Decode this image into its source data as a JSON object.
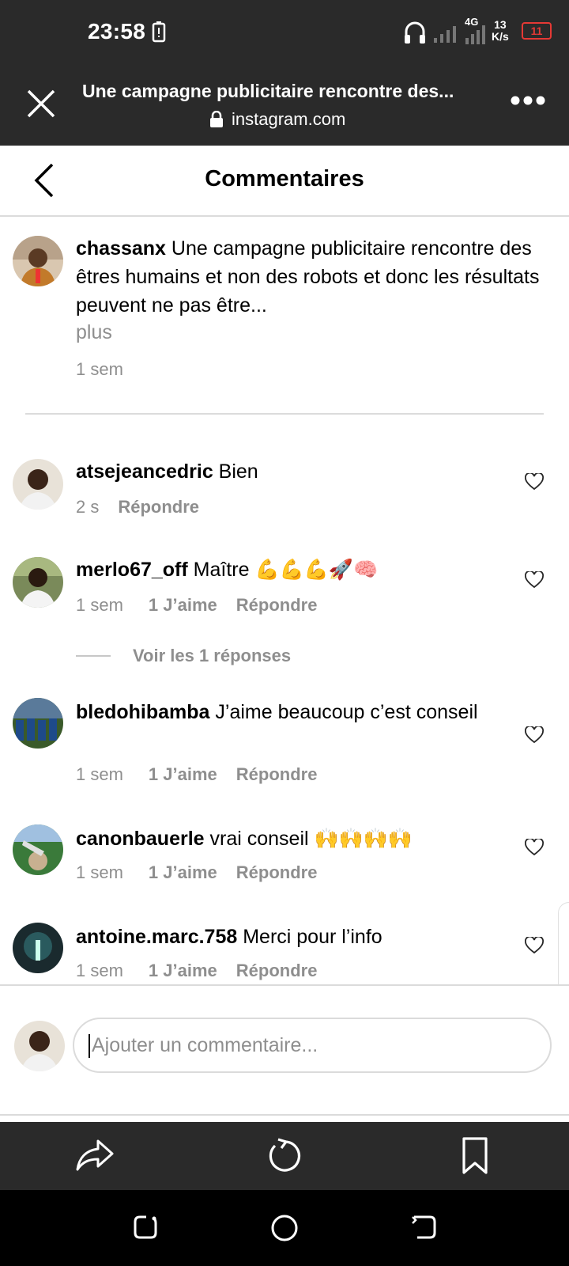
{
  "status_bar": {
    "time": "23:58",
    "network": "4G",
    "speed_value": "13",
    "speed_unit": "K/s",
    "battery": "11",
    "battery_color": "#e53935"
  },
  "browser": {
    "title": "Une campagne publicitaire rencontre des...",
    "url": "instagram.com"
  },
  "header": {
    "title": "Commentaires"
  },
  "caption": {
    "username": "chassanx",
    "text": "Une campagne publicitaire rencontre des êtres humains et non des robots et donc les résultats peuvent ne pas être...",
    "more": "plus",
    "time": "1 sem"
  },
  "comments": [
    {
      "username": "atsejeancedric",
      "text": "Bien",
      "time": "2 s",
      "likes": "",
      "reply": "Répondre"
    },
    {
      "username": "merlo67_off",
      "text": "Maître 💪💪💪🚀🧠",
      "time": "1 sem",
      "likes": "1 J’aime",
      "reply": "Répondre"
    },
    {
      "username": "bledohibamba",
      "text": "J’aime beaucoup c’est conseil",
      "time": "1 sem",
      "likes": "1 J’aime",
      "reply": "Répondre"
    },
    {
      "username": "canonbauerle",
      "text": "vrai conseil 🙌🙌🙌🙌",
      "time": "1 sem",
      "likes": "1 J’aime",
      "reply": "Répondre"
    },
    {
      "username": "antoine.marc.758",
      "text": "Merci pour l’info",
      "time": "1 sem",
      "likes": "1 J’aime",
      "reply": "Répondre"
    }
  ],
  "view_replies": "Voir les 1 réponses",
  "input": {
    "placeholder": "Ajouter un commentaire..."
  },
  "icons": {
    "close": "close-icon",
    "lock": "lock-icon",
    "more": "more-icon",
    "back": "chevron-left-icon",
    "heart": "heart-icon",
    "share": "share-icon",
    "reload": "reload-icon",
    "bookmark": "bookmark-icon"
  }
}
